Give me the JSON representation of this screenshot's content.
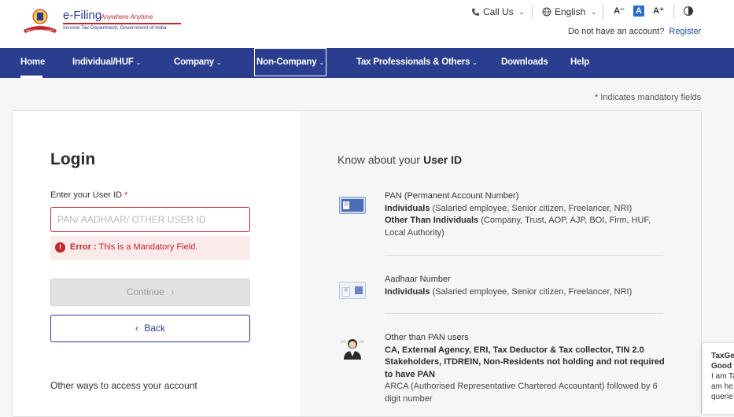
{
  "header": {
    "logo_title": "e-Filing",
    "logo_tagline": "Anywhere Anytime",
    "logo_subtitle": "Income Tax Department, Government of India",
    "call_us": "Call Us",
    "language": "English",
    "font_decrease": "A⁻",
    "font_default": "A",
    "font_increase": "A⁺",
    "no_account_text": "Do not have an account?",
    "register_link": "Register"
  },
  "nav": {
    "items": [
      {
        "label": "Home"
      },
      {
        "label": "Individual/HUF"
      },
      {
        "label": "Company"
      },
      {
        "label": "Non-Company"
      },
      {
        "label": "Tax Professionals & Others"
      },
      {
        "label": "Downloads"
      },
      {
        "label": "Help"
      }
    ]
  },
  "mandatory_note": {
    "star": "*",
    "text": " Indicates mandatory fields"
  },
  "login": {
    "title": "Login",
    "uid_label": "Enter your User ID",
    "uid_star": "*",
    "uid_placeholder": "PAN/ AADHAAR/ OTHER USER ID",
    "error_prefix": "Error :",
    "error_message": " This is a Mandatory Field.",
    "continue_label": "Continue",
    "back_label": "Back",
    "other_ways": "Other ways to access your account"
  },
  "know": {
    "title_prefix": "Know about your",
    "title_bold": "User ID",
    "blocks": [
      {
        "heading": "PAN (Permanent Account Number)",
        "line1_bold": "Individuals",
        "line1_rest": " (Salaried employee, Senior citizen, Freelancer, NRI)",
        "line2_bold": "Other Than Individuals",
        "line2_rest": " (Company, Trust, AOP, AJP, BOI, Firm, HUF, Local Authority)"
      },
      {
        "heading": "Aadhaar Number",
        "line1_bold": "Individuals",
        "line1_rest": " (Salaried employee, Senior citizen, Freelancer, NRI)"
      },
      {
        "heading": "Other than PAN users",
        "line1_bold": "CA, External Agency, ERI, Tax Deductor & Tax collector, TIN 2.0 Stakeholders, ITDREIN, Non-Residents not holding and not required to have PAN",
        "line2_rest": "ARCA (Authorised Representative Chartered Accountant) followed by 6 digit number"
      }
    ]
  },
  "side_widget": {
    "line1": "TaxGe",
    "line2": "Good",
    "line3": "I am Ta",
    "line4": "am he",
    "line5": "querie"
  },
  "colors": {
    "nav_bg": "#2a3d8f",
    "error": "#c0272d",
    "link": "#1e4da1"
  }
}
